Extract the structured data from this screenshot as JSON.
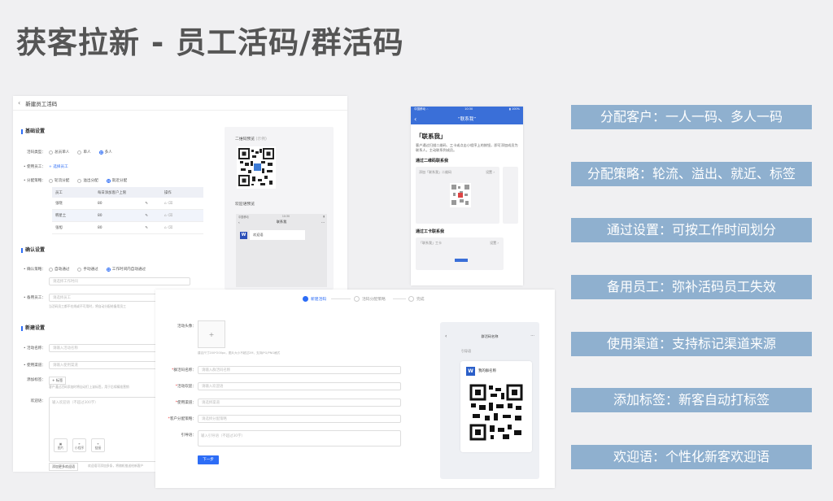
{
  "slide_title": "获客拉新 - 员工活码/群活码",
  "features": [
    "分配客户：一人一码、多人一码",
    "分配策略：轮流、溢出、就近、标签",
    "通过设置：可按工作时间划分",
    "备用员工：弥补活码员工失效",
    "使用渠道：支持标记渠道来源",
    "添加标签：新客自动打标签",
    "欢迎语：个性化新客欢迎语"
  ],
  "panel_a": {
    "header": "新建员工活码",
    "back": "‹",
    "section_basic": "基础设置",
    "type_label": "活码类型：",
    "type_options": [
      "总员单人",
      "单人",
      "多人"
    ],
    "staff_label": "• 使用员工：",
    "staff_link": "+ 选择员工",
    "strategy_label": "• 分配策略：",
    "strategy_options": [
      "轮流分配",
      "溢出分配",
      "就近分配"
    ],
    "table_headers": [
      "员工",
      "每日添加客户上限",
      "操作"
    ],
    "table_rows": [
      {
        "name": "张晓",
        "limit": "80"
      },
      {
        "name": "韩星土",
        "limit": "80"
      },
      {
        "name": "张旭",
        "limit": "80"
      }
    ],
    "section_confirm": "确认设置",
    "confirm_label": "• 确认策略：",
    "confirm_options": [
      "自动通过",
      "手动通过",
      "工作时间内自动通过"
    ],
    "confirm_placeholder": "请选择工作时间",
    "backup_label": "• 备用员工：",
    "backup_placeholder": "请选择员工",
    "backup_hint": "当活码员工都不在线或不可用时，将自动分配给备用员工",
    "section_new": "新建设置",
    "name_label": "• 活动名称：",
    "name_placeholder": "请输入活动名称",
    "channel_label": "• 使用渠道：",
    "channel_placeholder": "请输入使用渠道",
    "tag_label": "添加标签：",
    "tag_value": "+ 标签",
    "tag_hint": "客户通过活码添加时将自动打上该标签，用于后续精准营销",
    "welcome_label": "欢迎语：",
    "welcome_placeholder": "输入欢迎语（不超过300字）",
    "attach_buttons": [
      "图片",
      "小程序",
      "链接"
    ],
    "footer_btn": "添加更多欢迎语",
    "footer_hint": "欢迎语可添加多条，将随机推送给新客户",
    "preview_qr_label": "二维码预览",
    "preview_qr_sub": "(示例)",
    "preview_chat_label": "欢迎语预览",
    "preview_status_carrier": "中国移动",
    "preview_status_time": "10:30",
    "preview_contact": "联系我",
    "preview_bubble": "欢迎语"
  },
  "panel_b": {
    "status_left": "中国移动 ∴",
    "status_time": "10:30",
    "status_right": "▮ 100%",
    "nav_title": "“联系我”",
    "title": "「联系我」",
    "desc": "客户通过扫描二维码、工卡或点击小程序上的按钮，即可添加成员为联系人，主动联系到成员。",
    "sub1": "通过二维码联系我",
    "card1_title": "添加「联系我」二维码",
    "card1_action": "设置",
    "sub2": "通过工卡联系我",
    "card2_title": "「联系我」工卡",
    "card2_action": "设置"
  },
  "panel_c": {
    "steps": [
      "新建活码",
      "活码分配策略",
      "完成"
    ],
    "image_label": "活动头像：",
    "upload_plus": "+",
    "upload_hint": "建议尺寸200*200px，图片大小不超过2M，支持JPG/PNG格式",
    "fields": [
      {
        "label": "群活码名称",
        "placeholder": "请输入群活码名称"
      },
      {
        "label": "活动欢迎",
        "placeholder": "请输入欢迎语"
      },
      {
        "label": "使用渠道",
        "placeholder": "请选择渠道"
      },
      {
        "label": "客户分配策略",
        "placeholder": "请选择分配策略"
      }
    ],
    "desc_label": "引导语：",
    "desc_placeholder": "输入引导语（不超过30字）",
    "next_button": "下一步",
    "phone_title": "群活码名称",
    "phone_sub": "引导语",
    "phone_card_name": "我的群名称",
    "phone_card_logo": "W"
  }
}
